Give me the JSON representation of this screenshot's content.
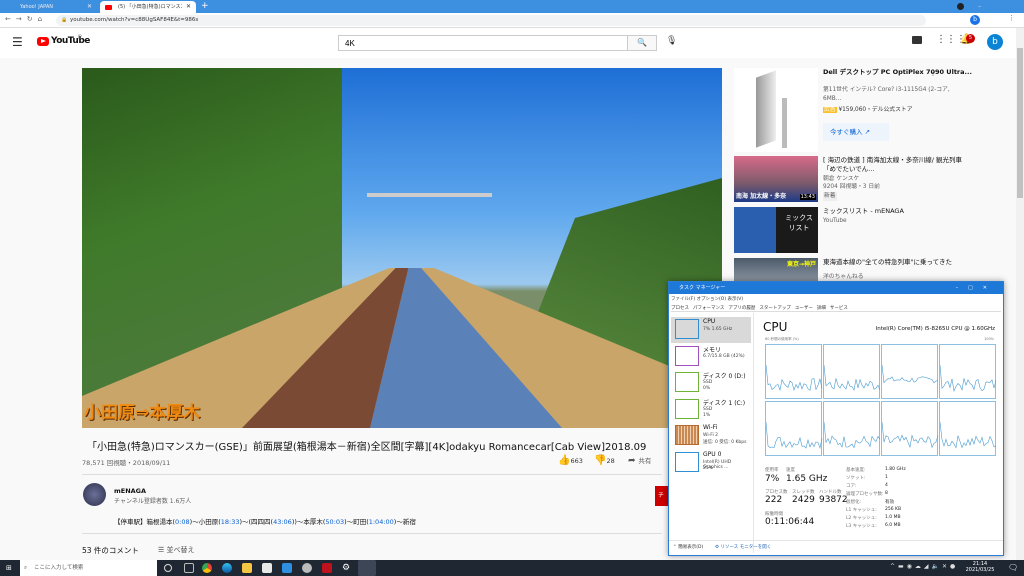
{
  "browser": {
    "tabs": [
      {
        "label": "Yahoo! JAPAN"
      },
      {
        "label": "(5) 「小田急(特急)ロマンスカー(GSE)」"
      }
    ],
    "url": "youtube.com/watch?v=c88UgSAF84E&t=986s",
    "profile_initial": "b"
  },
  "youtube": {
    "logo": "YouTube",
    "region": "JP",
    "search_value": "4K",
    "notification_count": "5",
    "avatar_initial": "b"
  },
  "video": {
    "overlay_caption": "小田原⇒本厚木",
    "title": "「小田急(特急)ロマンスカー(GSE)」前面展望(箱根湯本－新宿)全区間[字幕][4K]odakyu Romancecar[Cab View]2018.09",
    "views_date": "78,571 回視聴・2018/09/11",
    "likes": "663",
    "dislikes": "28",
    "share": "共有"
  },
  "channel": {
    "name": "mENAGA",
    "subscribers": "チャンネル登録者数 1.6万人",
    "subscribe_label": "チ"
  },
  "description": {
    "prefix": "【停車駅】箱根湯本(",
    "t1": "0:08",
    "s1": ")〜小田原(",
    "t2": "18:33",
    "s2": ")〜(四四四(",
    "t3": "43:06",
    "s3": "))〜本厚木(",
    "t4": "50:03",
    "s4": ")〜町田(",
    "t5": "1:04:00",
    "s5": ")〜新宿"
  },
  "comments": {
    "count": "53 件のコメント",
    "sort": "並べ替え"
  },
  "sidebar": {
    "ad": {
      "title": "Dell デスクトップ PC OptiPlex 7090 Ultra...",
      "desc": "第11世代 インテル? Core? i3-1115G4 (2-コア, 6MB...",
      "badge": "広告",
      "price": "¥159,060・デル公式ストア",
      "cta": "今すぐ購入"
    },
    "items": [
      {
        "title": "[ 海辺の鉄道 ] 南海加太線・多奈川線/ 観光列車「めでたいでん...",
        "channel": "朝倉 ケンスケ",
        "meta": "9204 回視聴・3 日前",
        "badge": "新着",
        "duration": "13:43",
        "thumb_text": "南海 加太線・多奈"
      },
      {
        "title": "ミックスリスト - mENAGA",
        "channel": "YouTube",
        "thumb_text": "ミックスリスト"
      },
      {
        "title": "東海道本線の\"全ての特急列車\"に乗ってきた",
        "channel": "洋のちゃんねる",
        "thumb_text": "東京→神戸"
      }
    ]
  },
  "taskmgr": {
    "title": "タスク マネージャー",
    "menu": [
      "ファイル(F)",
      "オプション(O)",
      "表示(V)"
    ],
    "tabs": [
      "プロセス",
      "パフォーマンス",
      "アプリの履歴",
      "スタートアップ",
      "ユーザー",
      "詳細",
      "サービス"
    ],
    "side": [
      {
        "name": "CPU",
        "sub1": "7% 1.65 GHz",
        "sub2": ""
      },
      {
        "name": "メモリ",
        "sub1": "6.7/15.8 GB (42%)",
        "sub2": ""
      },
      {
        "name": "ディスク 0 (D:)",
        "sub1": "SSD",
        "sub2": "0%"
      },
      {
        "name": "ディスク 1 (C:)",
        "sub1": "SSD",
        "sub2": "1%"
      },
      {
        "name": "Wi-Fi",
        "sub1": "Wi-Fi 2",
        "sub2": "送信: 0 受信: 0 Kbps"
      },
      {
        "name": "GPU 0",
        "sub1": "Intel(R) UHD Graphics ...",
        "sub2": "25%"
      }
    ],
    "heading": "CPU",
    "cpu_model": "Intel(R) Core(TM) i5-8265U CPU @ 1.60GHz",
    "graph_label": "60 秒間の使用率 (%)",
    "graph_max": "100%",
    "stats": {
      "usage_label": "使用率",
      "usage": "7%",
      "speed_label": "速度",
      "speed": "1.65 GHz",
      "proc_label": "プロセス数",
      "proc": "222",
      "thread_label": "スレッド数",
      "thread": "2429",
      "handle_label": "ハンドル数",
      "handle": "93872",
      "uptime_label": "稼働時間",
      "uptime": "0:11:06:44"
    },
    "specs": [
      [
        "基本速度:",
        "1.80 GHz"
      ],
      [
        "ソケット:",
        "1"
      ],
      [
        "コア:",
        "4"
      ],
      [
        "論理プロセッサ数:",
        "8"
      ],
      [
        "仮想化:",
        "有効"
      ],
      [
        "L1 キャッシュ:",
        "256 KB"
      ],
      [
        "L2 キャッシュ:",
        "1.0 MB"
      ],
      [
        "L3 キャッシュ:",
        "6.0 MB"
      ]
    ],
    "footer_simple": "簡易表示(D)",
    "footer_monitor": "リソース モニターを開く"
  },
  "taskbar": {
    "search_placeholder": "ここに入力して検索",
    "time": "21:14",
    "date": "2021/03/25"
  }
}
